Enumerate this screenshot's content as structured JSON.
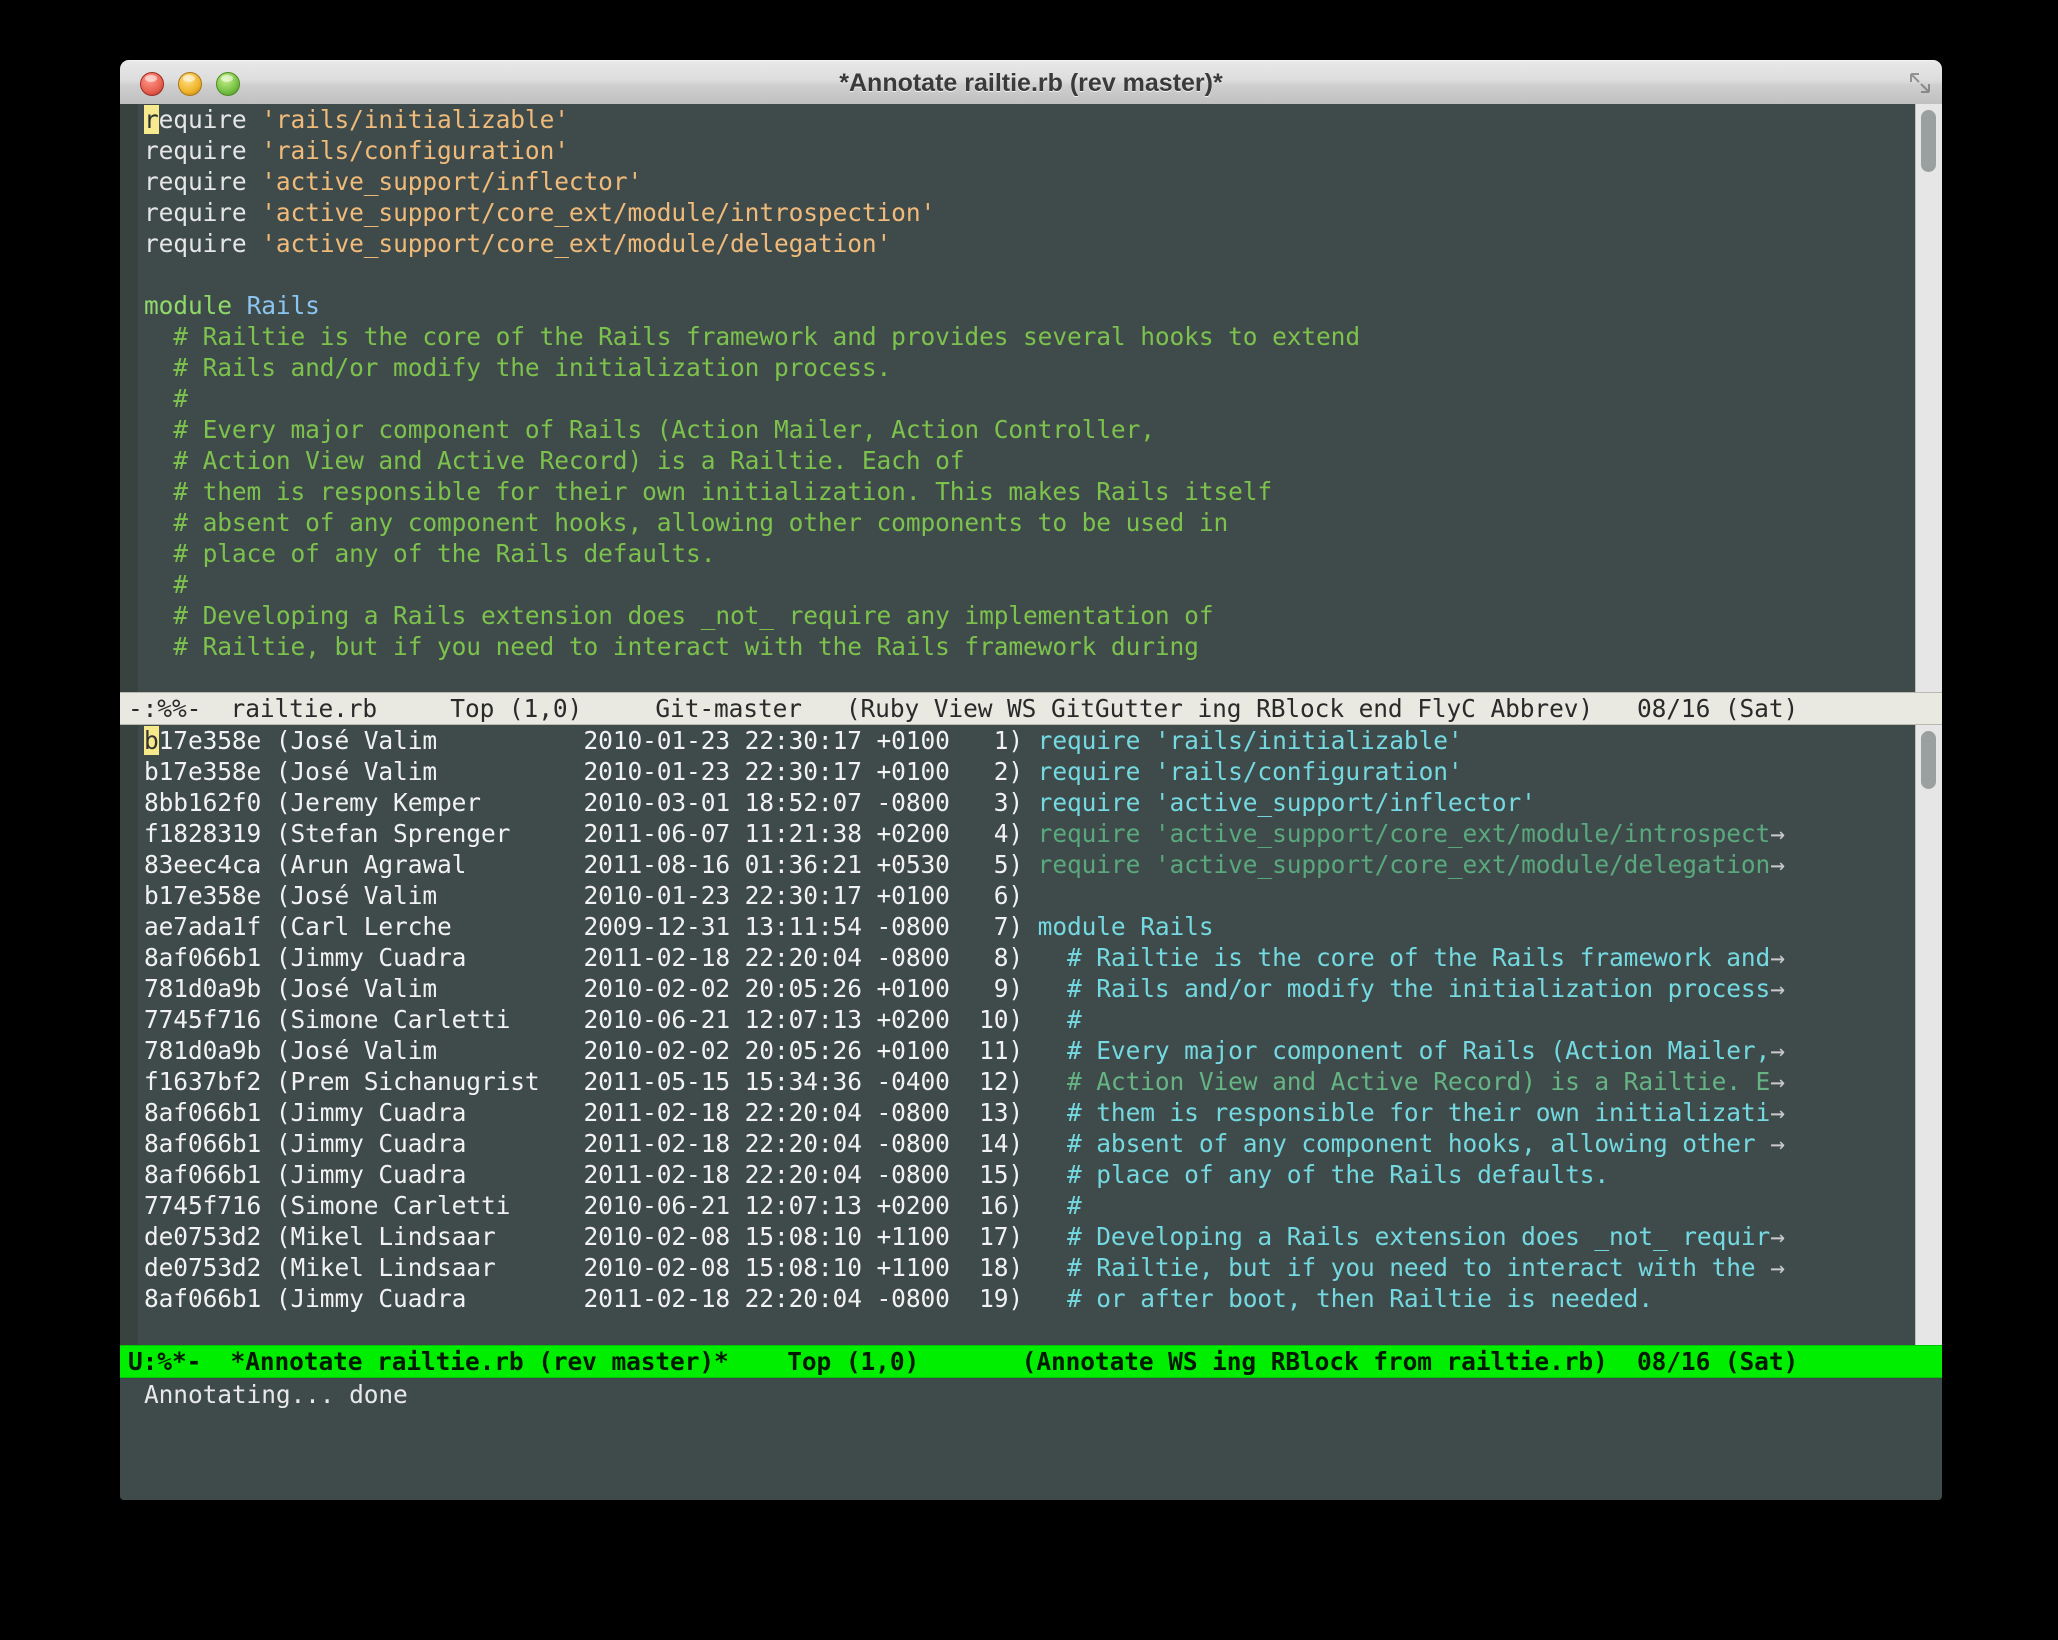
{
  "window": {
    "title": "*Annotate railtie.rb (rev master)*",
    "traffic_lights": [
      "close-button",
      "minimize-button",
      "zoom-button"
    ],
    "resize_grip_icon": "resize-grip-icon"
  },
  "source_pane": {
    "lines": [
      [
        {
          "t": "require",
          "c": "c-def"
        },
        {
          "t": " ",
          "c": "c-def"
        },
        {
          "t": "'rails/initializable'",
          "c": "c-str"
        }
      ],
      [
        {
          "t": "require",
          "c": "c-def"
        },
        {
          "t": " ",
          "c": "c-def"
        },
        {
          "t": "'rails/configuration'",
          "c": "c-str"
        }
      ],
      [
        {
          "t": "require",
          "c": "c-def"
        },
        {
          "t": " ",
          "c": "c-def"
        },
        {
          "t": "'active_support/inflector'",
          "c": "c-str"
        }
      ],
      [
        {
          "t": "require",
          "c": "c-def"
        },
        {
          "t": " ",
          "c": "c-def"
        },
        {
          "t": "'active_support/core_ext/module/introspection'",
          "c": "c-str"
        }
      ],
      [
        {
          "t": "require",
          "c": "c-def"
        },
        {
          "t": " ",
          "c": "c-def"
        },
        {
          "t": "'active_support/core_ext/module/delegation'",
          "c": "c-str"
        }
      ],
      [],
      [
        {
          "t": "module",
          "c": "c-kw"
        },
        {
          "t": " ",
          "c": "c-def"
        },
        {
          "t": "Rails",
          "c": "c-const"
        }
      ],
      [
        {
          "t": "  # Railtie is the core of the Rails framework and provides several hooks to extend",
          "c": "c-cmt"
        }
      ],
      [
        {
          "t": "  # Rails and/or modify the initialization process.",
          "c": "c-cmt"
        }
      ],
      [
        {
          "t": "  #",
          "c": "c-cmt"
        }
      ],
      [
        {
          "t": "  # Every major component of Rails (Action Mailer, Action Controller,",
          "c": "c-cmt"
        }
      ],
      [
        {
          "t": "  # Action View and Active Record) is a Railtie. Each of",
          "c": "c-cmt"
        }
      ],
      [
        {
          "t": "  # them is responsible for their own initialization. This makes Rails itself",
          "c": "c-cmt"
        }
      ],
      [
        {
          "t": "  # absent of any component hooks, allowing other components to be used in",
          "c": "c-cmt"
        }
      ],
      [
        {
          "t": "  # place of any of the Rails defaults.",
          "c": "c-cmt"
        }
      ],
      [
        {
          "t": "  #",
          "c": "c-cmt"
        }
      ],
      [
        {
          "t": "  # Developing a Rails extension does _not_ require any implementation of",
          "c": "c-cmt"
        }
      ],
      [
        {
          "t": "  # Railtie, but if you need to interact with the Rails framework during",
          "c": "c-cmt"
        }
      ]
    ],
    "cursor_char": "r",
    "modeline": {
      "mode_id": "-:%%-",
      "buffer": "railtie.rb",
      "position": "Top (1,0)",
      "vc": "Git-master",
      "modes": "(Ruby View WS GitGutter ing RBlock end FlyC Abbrev)",
      "date": "08/16 (Sat)",
      "full": "-:%%-  railtie.rb     Top (1,0)     Git-master   (Ruby View WS GitGutter ing RBlock end FlyC Abbrev)   08/16 (Sat)"
    }
  },
  "annotate_pane": {
    "columns": [
      "rev",
      "author",
      "timestamp",
      "lineno",
      "source"
    ],
    "rows": [
      {
        "rev": "b17e358e",
        "author": "(José Valim",
        "ts": "2010-01-23 22:30:17 +0100",
        "n": "1)",
        "src": "require 'rails/initializable'",
        "style": "c-src",
        "trunc": false
      },
      {
        "rev": "b17e358e",
        "author": "(José Valim",
        "ts": "2010-01-23 22:30:17 +0100",
        "n": "2)",
        "src": "require 'rails/configuration'",
        "style": "c-src",
        "trunc": false
      },
      {
        "rev": "8bb162f0",
        "author": "(Jeremy Kemper",
        "ts": "2010-03-01 18:52:07 -0800",
        "n": "3)",
        "src": "require 'active_support/inflector'",
        "style": "c-src",
        "trunc": false
      },
      {
        "rev": "f1828319",
        "author": "(Stefan Sprenger",
        "ts": "2011-06-07 11:21:38 +0200",
        "n": "4)",
        "src": "require 'active_support/core_ext/module/introspect",
        "style": "c-dim",
        "trunc": true
      },
      {
        "rev": "83eec4ca",
        "author": "(Arun Agrawal",
        "ts": "2011-08-16 01:36:21 +0530",
        "n": "5)",
        "src": "require 'active_support/core_ext/module/delegation",
        "style": "c-dim",
        "trunc": true
      },
      {
        "rev": "b17e358e",
        "author": "(José Valim",
        "ts": "2010-01-23 22:30:17 +0100",
        "n": "6)",
        "src": "",
        "style": "c-src",
        "trunc": false
      },
      {
        "rev": "ae7ada1f",
        "author": "(Carl Lerche",
        "ts": "2009-12-31 13:11:54 -0800",
        "n": "7)",
        "src": "module Rails",
        "style": "c-src",
        "trunc": false
      },
      {
        "rev": "8af066b1",
        "author": "(Jimmy Cuadra",
        "ts": "2011-02-18 22:20:04 -0800",
        "n": "8)",
        "src": "  # Railtie is the core of the Rails framework and",
        "style": "c-src",
        "trunc": true
      },
      {
        "rev": "781d0a9b",
        "author": "(José Valim",
        "ts": "2010-02-02 20:05:26 +0100",
        "n": "9)",
        "src": "  # Rails and/or modify the initialization process",
        "style": "c-src",
        "trunc": true
      },
      {
        "rev": "7745f716",
        "author": "(Simone Carletti",
        "ts": "2010-06-21 12:07:13 +0200",
        "n": "10)",
        "src": "  #",
        "style": "c-src",
        "trunc": false
      },
      {
        "rev": "781d0a9b",
        "author": "(José Valim",
        "ts": "2010-02-02 20:05:26 +0100",
        "n": "11)",
        "src": "  # Every major component of Rails (Action Mailer,",
        "style": "c-src",
        "trunc": true
      },
      {
        "rev": "f1637bf2",
        "author": "(Prem Sichanugrist",
        "ts": "2011-05-15 15:34:36 -0400",
        "n": "12)",
        "src": "  # Action View and Active Record) is a Railtie. E",
        "style": "c-dim2",
        "trunc": true
      },
      {
        "rev": "8af066b1",
        "author": "(Jimmy Cuadra",
        "ts": "2011-02-18 22:20:04 -0800",
        "n": "13)",
        "src": "  # them is responsible for their own initializati",
        "style": "c-src",
        "trunc": true
      },
      {
        "rev": "8af066b1",
        "author": "(Jimmy Cuadra",
        "ts": "2011-02-18 22:20:04 -0800",
        "n": "14)",
        "src": "  # absent of any component hooks, allowing other ",
        "style": "c-src",
        "trunc": true
      },
      {
        "rev": "8af066b1",
        "author": "(Jimmy Cuadra",
        "ts": "2011-02-18 22:20:04 -0800",
        "n": "15)",
        "src": "  # place of any of the Rails defaults.",
        "style": "c-src",
        "trunc": false
      },
      {
        "rev": "7745f716",
        "author": "(Simone Carletti",
        "ts": "2010-06-21 12:07:13 +0200",
        "n": "16)",
        "src": "  #",
        "style": "c-src",
        "trunc": false
      },
      {
        "rev": "de0753d2",
        "author": "(Mikel Lindsaar",
        "ts": "2010-02-08 15:08:10 +1100",
        "n": "17)",
        "src": "  # Developing a Rails extension does _not_ requir",
        "style": "c-src",
        "trunc": true
      },
      {
        "rev": "de0753d2",
        "author": "(Mikel Lindsaar",
        "ts": "2010-02-08 15:08:10 +1100",
        "n": "18)",
        "src": "  # Railtie, but if you need to interact with the ",
        "style": "c-src",
        "trunc": true
      },
      {
        "rev": "8af066b1",
        "author": "(Jimmy Cuadra",
        "ts": "2011-02-18 22:20:04 -0800",
        "n": "19)",
        "src": "  # or after boot, then Railtie is needed.",
        "style": "c-src",
        "trunc": false
      }
    ],
    "cursor_char": "b",
    "modeline": {
      "mode_id": "U:%*-",
      "buffer": "*Annotate railtie.rb (rev master)*",
      "position": "Top (1,0)",
      "modes": "(Annotate WS ing RBlock from railtie.rb)",
      "date": "08/16 (Sat)",
      "full": "U:%*-  *Annotate railtie.rb (rev master)*    Top (1,0)       (Annotate WS ing RBlock from railtie.rb)  08/16 (Sat)"
    }
  },
  "minibuffer": {
    "message": "Annotating... done"
  },
  "colors": {
    "background": "#3f4b4b",
    "comment": "#7cc24c",
    "string": "#f0bb7a",
    "keyword": "#8fd96a",
    "constant": "#8cc4f0",
    "source_line": "#74d9e0",
    "dimmed_line": "#5aa87d",
    "active_modeline_bg": "#00ef00",
    "inactive_modeline_bg": "#e9e9e2",
    "cursor": "#f7e98e"
  }
}
